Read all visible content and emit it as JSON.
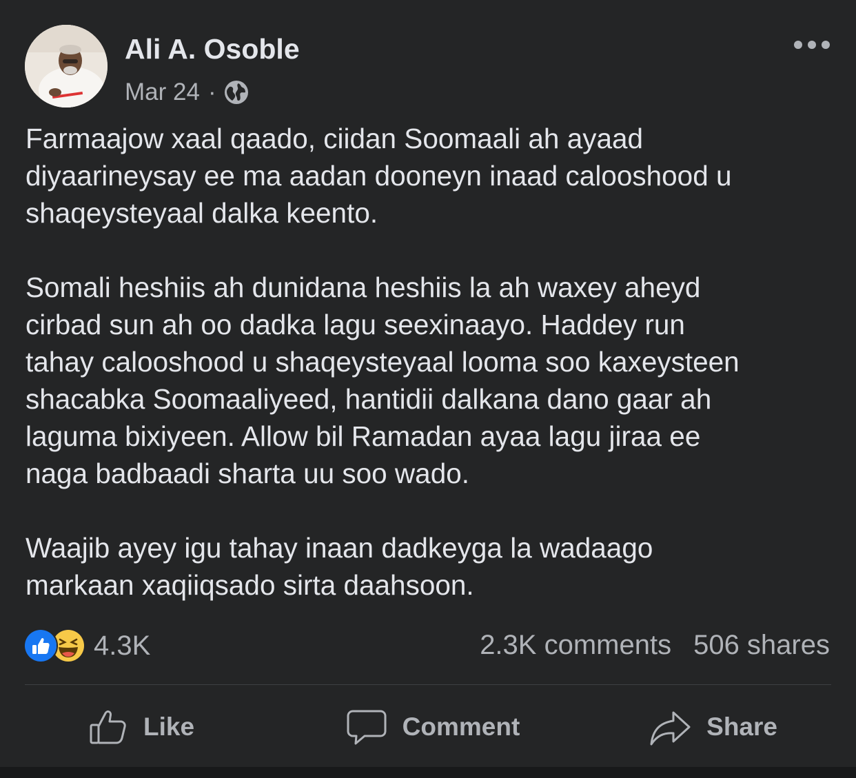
{
  "post": {
    "author": "Ali A. Osoble",
    "date": "Mar 24",
    "separator": "·",
    "audience_icon": "globe-icon",
    "more_icon": "more-options-icon",
    "paragraphs": [
      [
        "Farmaajow xaal qaado, ciidan Soomaali ah ayaad",
        "diyaarineysay ee ma aadan dooneyn inaad calooshood u",
        "shaqeysteyaal dalka keento."
      ],
      [
        "Somali heshiis ah dunidana heshiis la ah waxey aheyd",
        "cirbad sun ah oo dadka lagu seexinaayo. Haddey run",
        "tahay calooshood u shaqeysteyaal looma soo kaxeysteen",
        "shacabka Soomaaliyeed, hantidii dalkana dano gaar ah",
        "laguma bixiyeen. Allow bil Ramadan ayaa lagu jiraa ee",
        "naga badbaadi sharta uu soo wado."
      ],
      [
        "Waajib ayey igu tahay inaan dadkeyga la wadaago",
        "markaan xaqiiqsado sirta daahsoon."
      ]
    ]
  },
  "stats": {
    "reactions": [
      "like-reaction-icon",
      "haha-reaction-icon"
    ],
    "reaction_count": "4.3K",
    "comments": "2.3K comments",
    "shares": "506 shares"
  },
  "actions": {
    "like": "Like",
    "comment": "Comment",
    "share": "Share"
  },
  "colors": {
    "background": "#242526",
    "primary_text": "#e4e6eb",
    "secondary_text": "#b0b3b8",
    "like_blue": "#1877f2",
    "haha_yellow": "#f7c948"
  }
}
